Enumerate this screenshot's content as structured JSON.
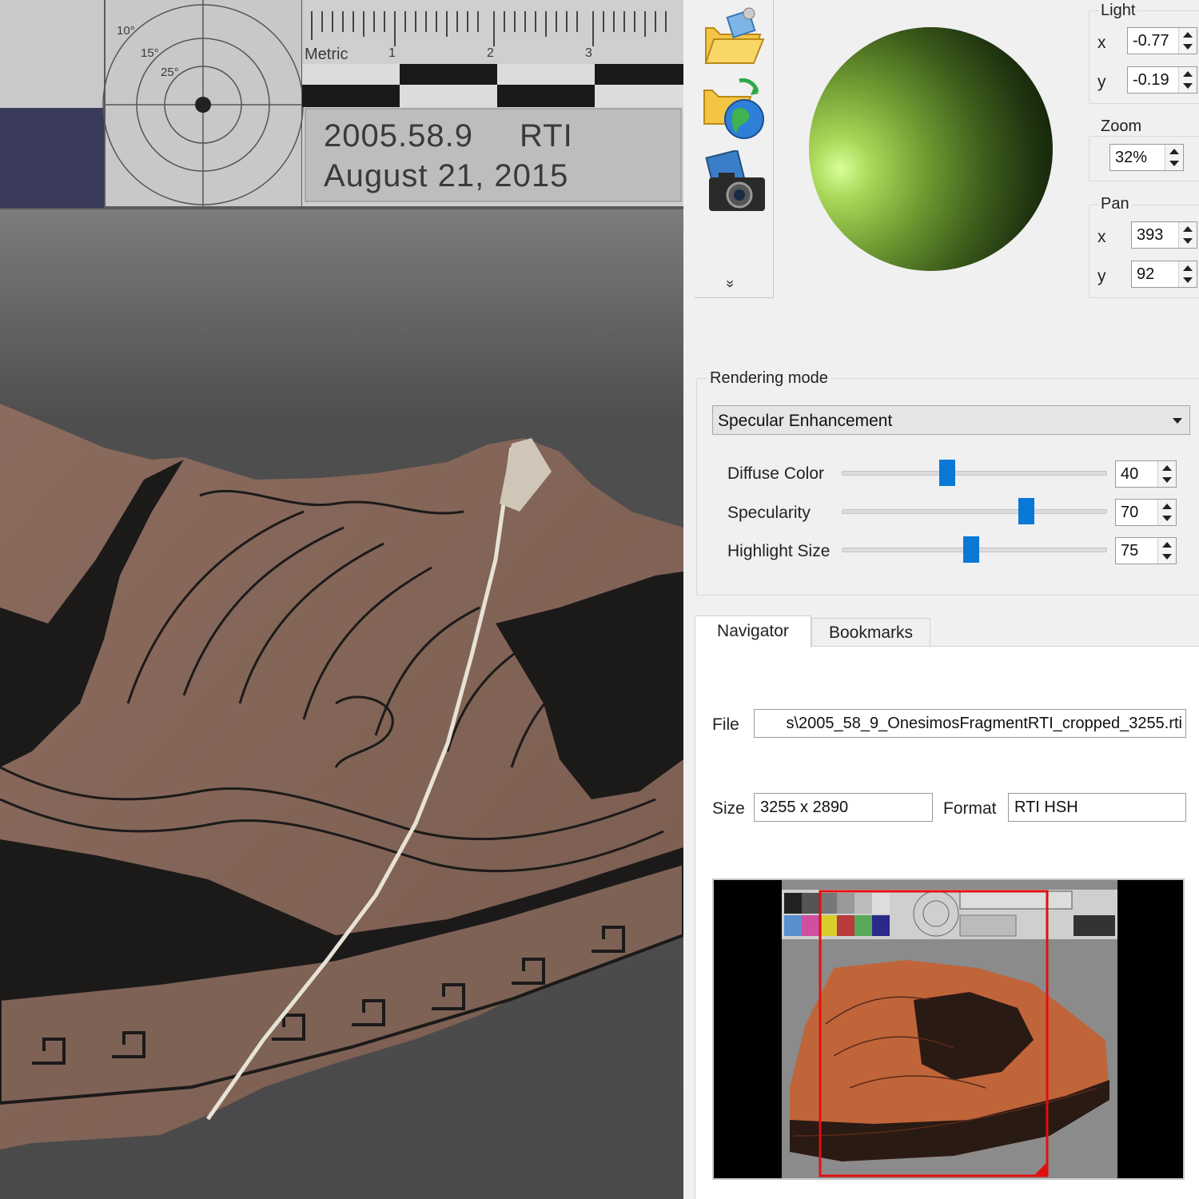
{
  "viewer": {
    "label_id": "2005.58.9",
    "label_rti": "RTI",
    "label_date": "August 21, 2015",
    "ruler_metric": "Metric",
    "ruler_ticks": [
      "1",
      "2",
      "3"
    ],
    "target_angles": [
      "10°",
      "15°",
      "25°"
    ]
  },
  "toolbar": {
    "more_glyph": "»"
  },
  "light": {
    "title": "Light",
    "x_label": "x",
    "x_value": "-0.77",
    "y_label": "y",
    "y_value": "-0.19"
  },
  "zoom": {
    "title": "Zoom",
    "value": "32%"
  },
  "pan": {
    "title": "Pan",
    "x_label": "x",
    "x_value": "393",
    "y_label": "y",
    "y_value": "92"
  },
  "rendering": {
    "title": "Rendering mode",
    "mode": "Specular Enhancement",
    "params": [
      {
        "label": "Diffuse Color",
        "value": "40",
        "level": 0.4
      },
      {
        "label": "Specularity",
        "value": "70",
        "level": 0.7
      },
      {
        "label": "Highlight Size",
        "value": "75",
        "level": 0.49
      }
    ]
  },
  "tabs": {
    "navigator": "Navigator",
    "bookmarks": "Bookmarks"
  },
  "info": {
    "file_label": "File",
    "file_value": "s\\2005_58_9_OnesimosFragmentRTI_cropped_3255.rti",
    "size_label": "Size",
    "size_value": "3255 x 2890",
    "format_label": "Format",
    "format_value": "RTI HSH"
  },
  "colors": {
    "accent": "#0a78d7",
    "viewport_rect": "#e01010"
  }
}
